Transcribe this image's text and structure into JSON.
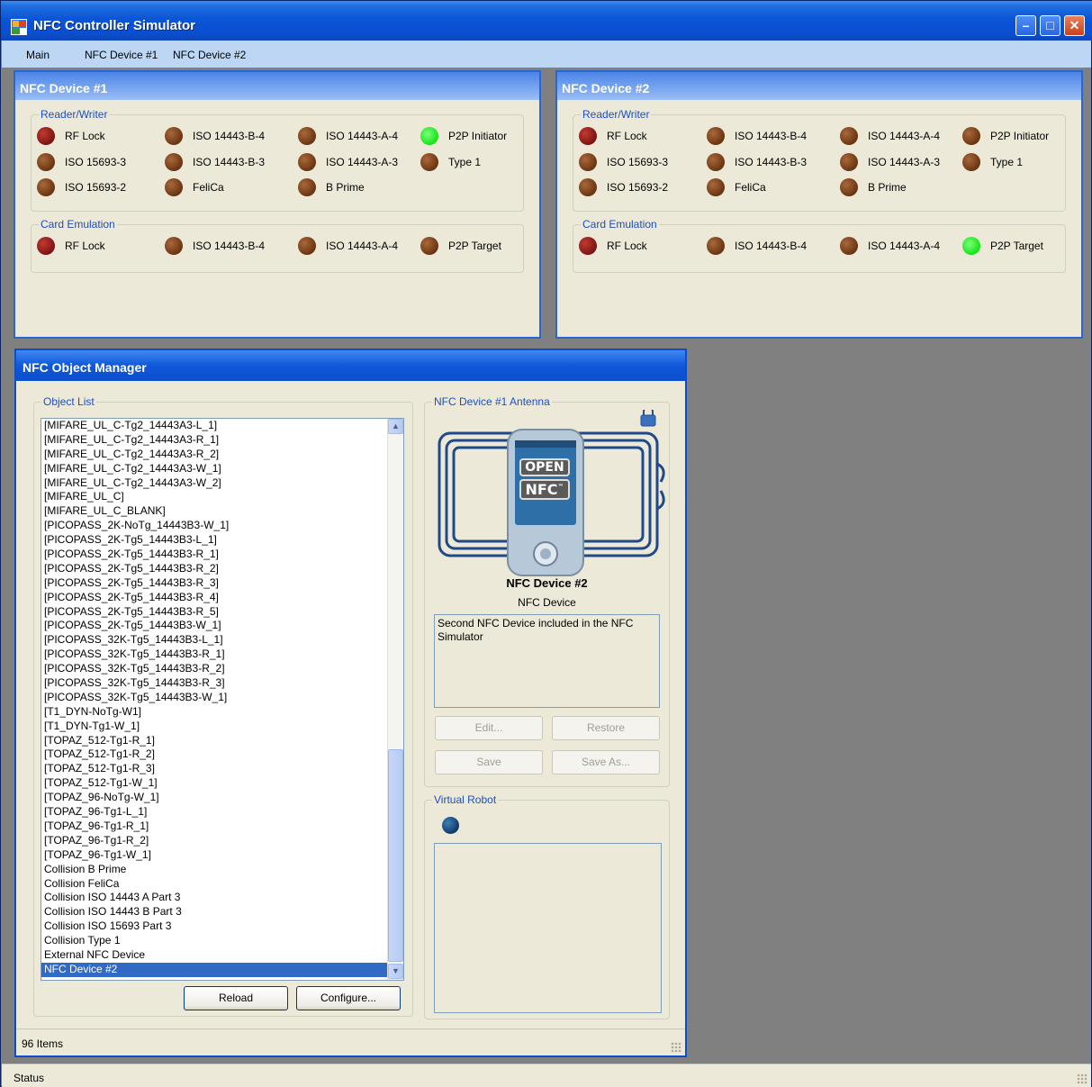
{
  "window": {
    "title": "NFC Controller Simulator"
  },
  "menu": {
    "items": [
      "Main",
      "NFC Device #1",
      "NFC Device #2"
    ]
  },
  "device1": {
    "title": "NFC Device #1",
    "reader_writer": {
      "label": "Reader/Writer",
      "leds": [
        {
          "label": "RF Lock",
          "state": "red"
        },
        {
          "label": "ISO 14443-B-4",
          "state": "off"
        },
        {
          "label": "ISO 14443-A-4",
          "state": "off"
        },
        {
          "label": "P2P Initiator",
          "state": "green"
        },
        {
          "label": "ISO 15693-3",
          "state": "off"
        },
        {
          "label": "ISO 14443-B-3",
          "state": "off"
        },
        {
          "label": "ISO 14443-A-3",
          "state": "off"
        },
        {
          "label": "Type 1",
          "state": "off"
        },
        {
          "label": "ISO 15693-2",
          "state": "off"
        },
        {
          "label": "FeliCa",
          "state": "off"
        },
        {
          "label": "B Prime",
          "state": "off"
        }
      ]
    },
    "card_emulation": {
      "label": "Card Emulation",
      "leds": [
        {
          "label": "RF Lock",
          "state": "red"
        },
        {
          "label": "ISO 14443-B-4",
          "state": "off"
        },
        {
          "label": "ISO 14443-A-4",
          "state": "off"
        },
        {
          "label": "P2P Target",
          "state": "off"
        }
      ]
    }
  },
  "device2": {
    "title": "NFC Device #2",
    "reader_writer": {
      "label": "Reader/Writer",
      "leds": [
        {
          "label": "RF Lock",
          "state": "red"
        },
        {
          "label": "ISO 14443-B-4",
          "state": "off"
        },
        {
          "label": "ISO 14443-A-4",
          "state": "off"
        },
        {
          "label": "P2P Initiator",
          "state": "off"
        },
        {
          "label": "ISO 15693-3",
          "state": "off"
        },
        {
          "label": "ISO 14443-B-3",
          "state": "off"
        },
        {
          "label": "ISO 14443-A-3",
          "state": "off"
        },
        {
          "label": "Type 1",
          "state": "off"
        },
        {
          "label": "ISO 15693-2",
          "state": "off"
        },
        {
          "label": "FeliCa",
          "state": "off"
        },
        {
          "label": "B Prime",
          "state": "off"
        }
      ]
    },
    "card_emulation": {
      "label": "Card Emulation",
      "leds": [
        {
          "label": "RF Lock",
          "state": "red"
        },
        {
          "label": "ISO 14443-B-4",
          "state": "off"
        },
        {
          "label": "ISO 14443-A-4",
          "state": "off"
        },
        {
          "label": "P2P Target",
          "state": "green"
        }
      ]
    }
  },
  "object_manager": {
    "title": "NFC Object Manager",
    "object_list_label": "Object List",
    "items": [
      "[MIFARE_UL_C-Tg2_14443A3-L_1]",
      "[MIFARE_UL_C-Tg2_14443A3-R_1]",
      "[MIFARE_UL_C-Tg2_14443A3-R_2]",
      "[MIFARE_UL_C-Tg2_14443A3-W_1]",
      "[MIFARE_UL_C-Tg2_14443A3-W_2]",
      "[MIFARE_UL_C]",
      "[MIFARE_UL_C_BLANK]",
      "[PICOPASS_2K-NoTg_14443B3-W_1]",
      "[PICOPASS_2K-Tg5_14443B3-L_1]",
      "[PICOPASS_2K-Tg5_14443B3-R_1]",
      "[PICOPASS_2K-Tg5_14443B3-R_2]",
      "[PICOPASS_2K-Tg5_14443B3-R_3]",
      "[PICOPASS_2K-Tg5_14443B3-R_4]",
      "[PICOPASS_2K-Tg5_14443B3-R_5]",
      "[PICOPASS_2K-Tg5_14443B3-W_1]",
      "[PICOPASS_32K-Tg5_14443B3-L_1]",
      "[PICOPASS_32K-Tg5_14443B3-R_1]",
      "[PICOPASS_32K-Tg5_14443B3-R_2]",
      "[PICOPASS_32K-Tg5_14443B3-R_3]",
      "[PICOPASS_32K-Tg5_14443B3-W_1]",
      "[T1_DYN-NoTg-W1]",
      "[T1_DYN-Tg1-W_1]",
      "[TOPAZ_512-Tg1-R_1]",
      "[TOPAZ_512-Tg1-R_2]",
      "[TOPAZ_512-Tg1-R_3]",
      "[TOPAZ_512-Tg1-W_1]",
      "[TOPAZ_96-NoTg-W_1]",
      "[TOPAZ_96-Tg1-L_1]",
      "[TOPAZ_96-Tg1-R_1]",
      "[TOPAZ_96-Tg1-R_2]",
      "[TOPAZ_96-Tg1-W_1]",
      "Collision B Prime",
      "Collision FeliCa",
      "Collision ISO 14443 A Part 3",
      "Collision ISO 14443 B Part 3",
      "Collision ISO 15693 Part 3",
      "Collision Type 1",
      "External NFC Device",
      "NFC Device #2"
    ],
    "selected_item": "NFC Device #2",
    "reload_label": "Reload",
    "configure_label": "Configure...",
    "antenna_label": "NFC Device #1 Antenna",
    "device_name": "NFC Device #2",
    "device_type": "NFC Device",
    "description": "Second NFC Device included in the NFC Simulator",
    "edit_label": "Edit...",
    "restore_label": "Restore",
    "save_label": "Save",
    "save_as_label": "Save As...",
    "virtual_robot_label": "Virtual Robot",
    "item_count": "96 Items",
    "logo_top": "OPEN",
    "logo_bottom": "NFC"
  },
  "status": {
    "text": "Status"
  },
  "colors": {
    "led_green": "#14e414",
    "led_red": "#7d1414",
    "led_off": "#6a3512",
    "selection": "#316ac5"
  }
}
